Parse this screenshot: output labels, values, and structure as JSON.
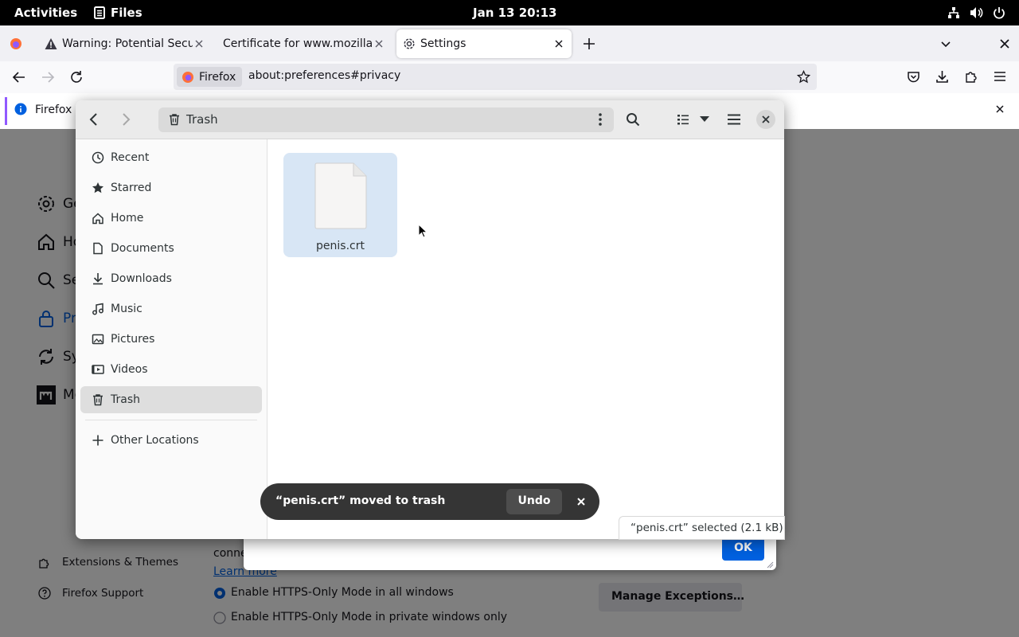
{
  "gnome_bar": {
    "activities": "Activities",
    "app_name": "Files",
    "clock": "Jan 13  20:13"
  },
  "browser": {
    "tabs": [
      {
        "label": "Warning: Potential Securi"
      },
      {
        "label": "Certificate for www.mozilla.c"
      },
      {
        "label": "Settings"
      }
    ],
    "identity_label": "Firefox",
    "url": "about:preferences#privacy",
    "notification_text": "Firefox a"
  },
  "settings_page": {
    "nav": [
      {
        "label": "Ge"
      },
      {
        "label": "Ho"
      },
      {
        "label": "Se"
      },
      {
        "label": "Pr"
      },
      {
        "label": "Sy"
      },
      {
        "label": "Mo"
      }
    ],
    "footer_links": {
      "extensions": "Extensions & Themes",
      "support": "Firefox Support"
    },
    "text_conn": "conne",
    "learn_more": "Learn more",
    "https_all": "Enable HTTPS-Only Mode in all windows",
    "https_private": "Enable HTTPS-Only Mode in private windows only",
    "manage_exceptions": "Manage Exceptions…",
    "ok_button": "OK"
  },
  "file_chooser": {
    "path_current": "Trash",
    "sidebar": [
      {
        "label": "Recent",
        "icon": "clock-icon"
      },
      {
        "label": "Starred",
        "icon": "star-icon"
      },
      {
        "label": "Home",
        "icon": "home-icon"
      },
      {
        "label": "Documents",
        "icon": "document-icon"
      },
      {
        "label": "Downloads",
        "icon": "download-icon"
      },
      {
        "label": "Music",
        "icon": "music-icon"
      },
      {
        "label": "Pictures",
        "icon": "picture-icon"
      },
      {
        "label": "Videos",
        "icon": "video-icon"
      },
      {
        "label": "Trash",
        "icon": "trash-icon",
        "selected": true
      },
      {
        "label": "Other Locations",
        "icon": "plus-icon"
      }
    ],
    "files": [
      {
        "name": "penis.crt",
        "selected": true
      }
    ],
    "toast_message": "“penis.crt” moved to trash",
    "toast_undo": "Undo",
    "status": "“penis.crt” selected  (2.1 kB)"
  },
  "colors": {
    "accent_blue": "#0061e0",
    "selection": "#d8e6f5",
    "toast_bg": "#353535"
  }
}
